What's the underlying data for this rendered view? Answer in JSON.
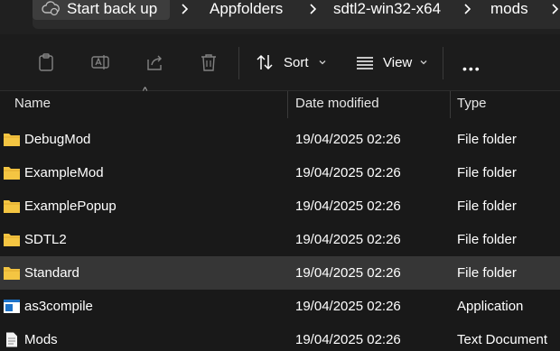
{
  "breadcrumb": {
    "items": [
      "Start back up",
      "Appfolders",
      "sdtl2-win32-x64",
      "mods"
    ]
  },
  "toolbar": {
    "sort_label": "Sort",
    "view_label": "View",
    "more_label": "•••"
  },
  "columns": {
    "name": "Name",
    "date": "Date modified",
    "type": "Type"
  },
  "files": [
    {
      "name": "DebugMod",
      "date": "19/04/2025 02:26",
      "type": "File folder",
      "icon": "folder-icon"
    },
    {
      "name": "ExampleMod",
      "date": "19/04/2025 02:26",
      "type": "File folder",
      "icon": "folder-icon"
    },
    {
      "name": "ExamplePopup",
      "date": "19/04/2025 02:26",
      "type": "File folder",
      "icon": "folder-icon"
    },
    {
      "name": "SDTL2",
      "date": "19/04/2025 02:26",
      "type": "File folder",
      "icon": "folder-icon"
    },
    {
      "name": "Standard",
      "date": "19/04/2025 02:26",
      "type": "File folder",
      "icon": "folder-icon",
      "selected": true
    },
    {
      "name": "as3compile",
      "date": "19/04/2025 02:26",
      "type": "Application",
      "icon": "application-icon"
    },
    {
      "name": "Mods",
      "date": "19/04/2025 02:26",
      "type": "Text Document",
      "icon": "text-document-icon"
    }
  ],
  "colors": {
    "background": "#191919",
    "selected_row": "#363636",
    "folder": "#f4c542"
  }
}
